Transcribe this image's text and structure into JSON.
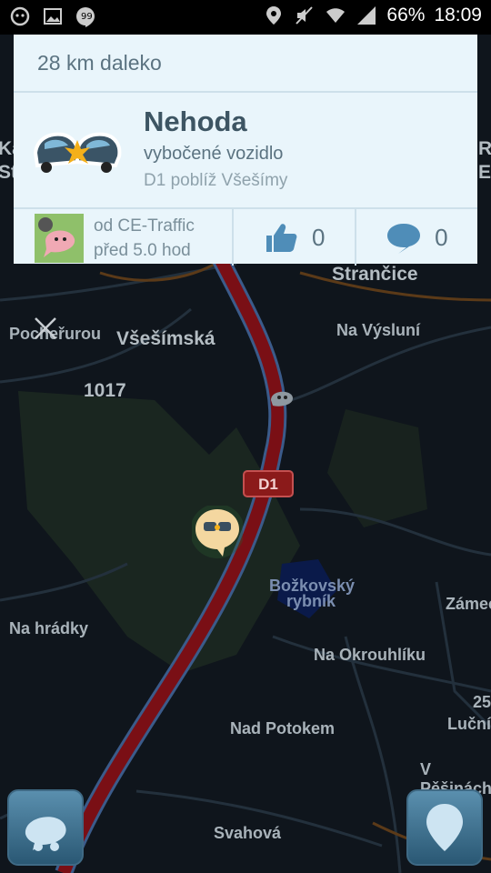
{
  "status_bar": {
    "battery": "66%",
    "time": "18:09",
    "left_icons": [
      "waze-status-icon",
      "image-icon",
      "hangouts-icon"
    ],
    "right_icons": [
      "location-icon",
      "mute-icon",
      "wifi-icon",
      "signal-icon"
    ]
  },
  "alert_card": {
    "distance": "28 km daleko",
    "title": "Nehoda",
    "subtitle": "vybočené vozidlo",
    "location": "D1 poblíž Všešímy",
    "source": "od CE-Traffic",
    "time_ago": "před 5.0 hod",
    "likes": "0",
    "comments": "0"
  },
  "map": {
    "road_shield": "D1",
    "labels": {
      "strancice": "Strančice",
      "pocernurou": "Pocheřurou",
      "vsesimska": "Všešímská",
      "na_vysluni": "Na Výsluní",
      "n1017": "1017",
      "bozkovsky1": "Božkovský",
      "bozkovsky2": "rybník",
      "na_hradky": "Na hrádky",
      "zamec": "Zámec",
      "na_okrouhliku": "Na Okrouhlíku",
      "nad_potokem": "Nad Potokem",
      "lucni": "Luční",
      "v_pesinach": "V Pěšinách",
      "svahova": "Svahová",
      "left_edge": "Ka",
      "left_edge2": "St",
      "right_edge": "R",
      "right_edge2": "E",
      "right_edge3": "25"
    }
  },
  "colors": {
    "traffic": "#7a0f15",
    "card_bg": "#e9f5fb",
    "button": "#3f7394"
  }
}
